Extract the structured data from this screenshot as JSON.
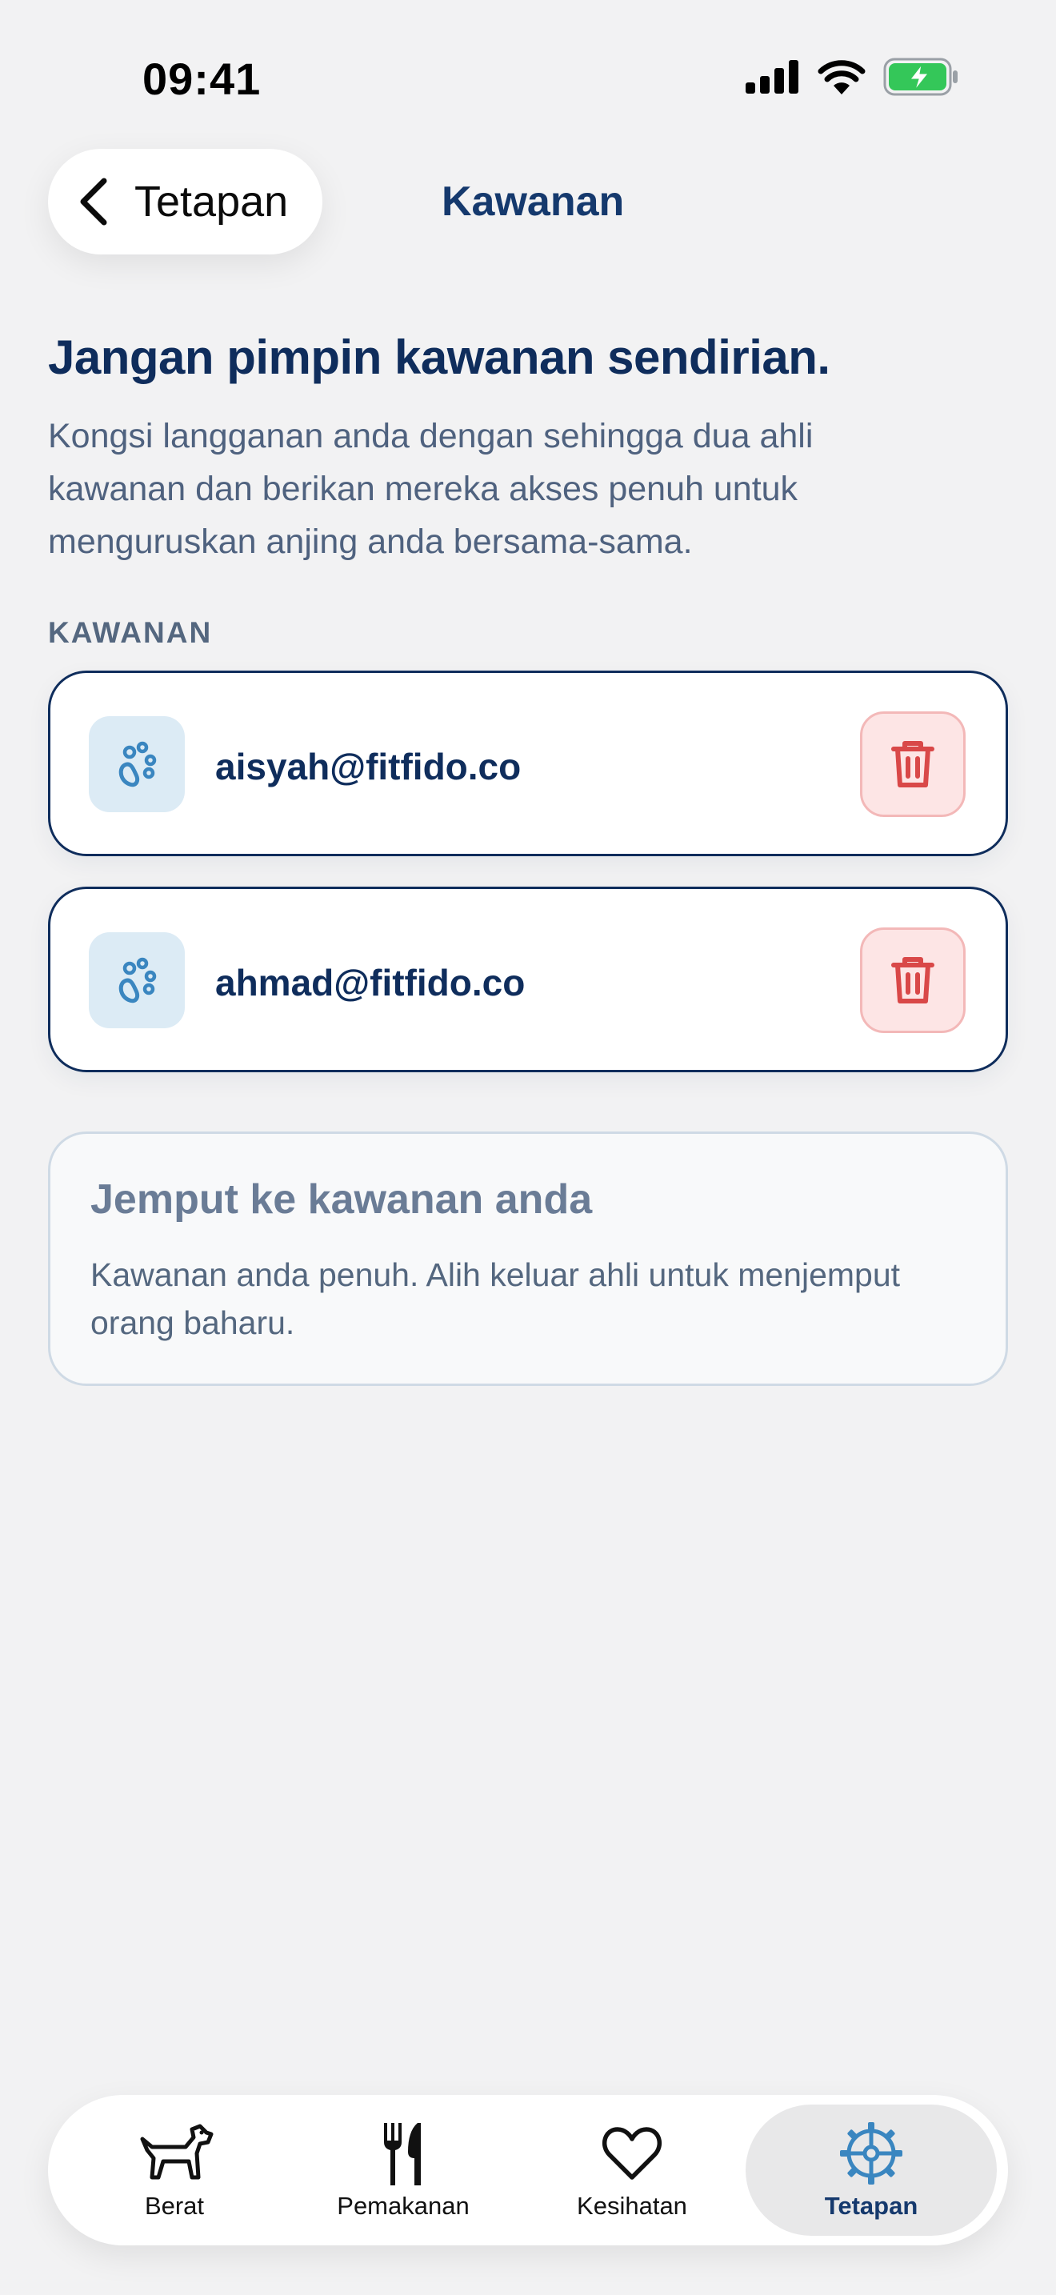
{
  "status": {
    "time": "09:41"
  },
  "nav": {
    "back_label": "Tetapan",
    "title": "Kawanan"
  },
  "hero": {
    "title": "Jangan pimpin kawanan sendirian.",
    "description": "Kongsi langganan anda dengan sehingga dua ahli kawanan dan berikan mereka akses penuh untuk menguruskan anjing anda bersama-sama."
  },
  "section_label": "KAWANAN",
  "members": [
    {
      "email": "aisyah@fitfido.co"
    },
    {
      "email": "ahmad@fitfido.co"
    }
  ],
  "invite": {
    "title": "Jemput ke kawanan anda",
    "description": "Kawanan anda penuh. Alih keluar ahli untuk menjemput orang baharu."
  },
  "tabs": [
    {
      "label": "Berat",
      "icon": "dog-icon"
    },
    {
      "label": "Pemakanan",
      "icon": "fork-knife-icon"
    },
    {
      "label": "Kesihatan",
      "icon": "heart-icon"
    },
    {
      "label": "Tetapan",
      "icon": "gear-icon",
      "active": true
    }
  ],
  "colors": {
    "primary": "#0f2d5c",
    "accent": "#3a86c0",
    "danger": "#d94848",
    "battery": "#34c759"
  }
}
